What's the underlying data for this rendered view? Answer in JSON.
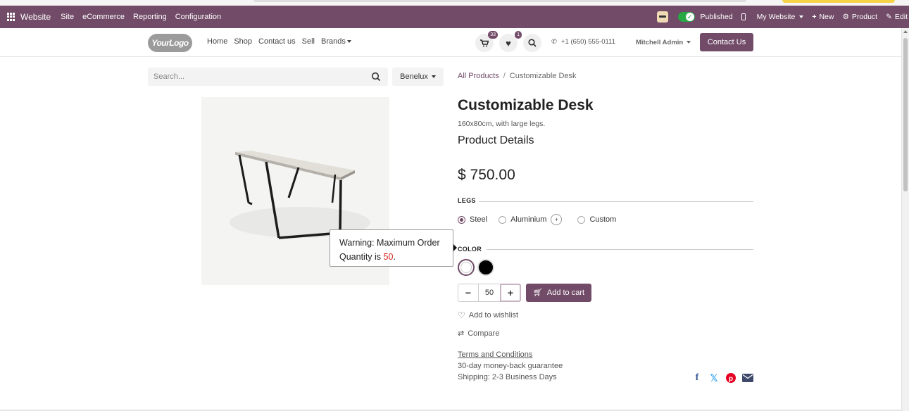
{
  "admin_bar": {
    "brand": "Website",
    "menu": [
      "Site",
      "eCommerce",
      "Reporting",
      "Configuration"
    ],
    "published": "Published",
    "my_website": "My Website",
    "new": "New",
    "product": "Product",
    "edit": "Edit",
    "bg_color": "#714b67"
  },
  "header": {
    "logo": "YourLogo",
    "nav": [
      "Home",
      "Shop",
      "Contact us",
      "Sell",
      "Brands"
    ],
    "cart_count": "33",
    "wishlist_count": "1",
    "phone": "+1 (650) 555-0111",
    "user": "Mitchell Admin",
    "contact_button": "Contact Us"
  },
  "search": {
    "placeholder": "Search...",
    "pricelist": "Benelux"
  },
  "breadcrumb": {
    "parent": "All Products",
    "current": "Customizable Desk"
  },
  "product": {
    "name": "Customizable Desk",
    "description": "160x80cm, with large legs.",
    "details_heading": "Product Details",
    "price": "$ 750.00",
    "legs_title": "LEGS",
    "legs_options": [
      "Steel",
      "Aluminium",
      "Custom"
    ],
    "legs_selected": "Steel",
    "aluminium_extra": "+",
    "color_title": "COLOR",
    "colors": [
      "#ffffff",
      "#000000"
    ],
    "quantity": "50",
    "add_to_cart": "Add to cart",
    "wishlist": "Add to wishlist",
    "compare": "Compare",
    "terms": "Terms and Conditions",
    "guarantee": "30-day money-back guarantee",
    "shipping": "Shipping: 2-3 Business Days"
  },
  "tooltip": {
    "text_before": "Warning: Maximum Order Quantity is",
    "max_quantity": "50",
    "text_after": "."
  },
  "social": [
    "facebook-icon",
    "x-icon",
    "pinterest-icon",
    "email-icon"
  ]
}
